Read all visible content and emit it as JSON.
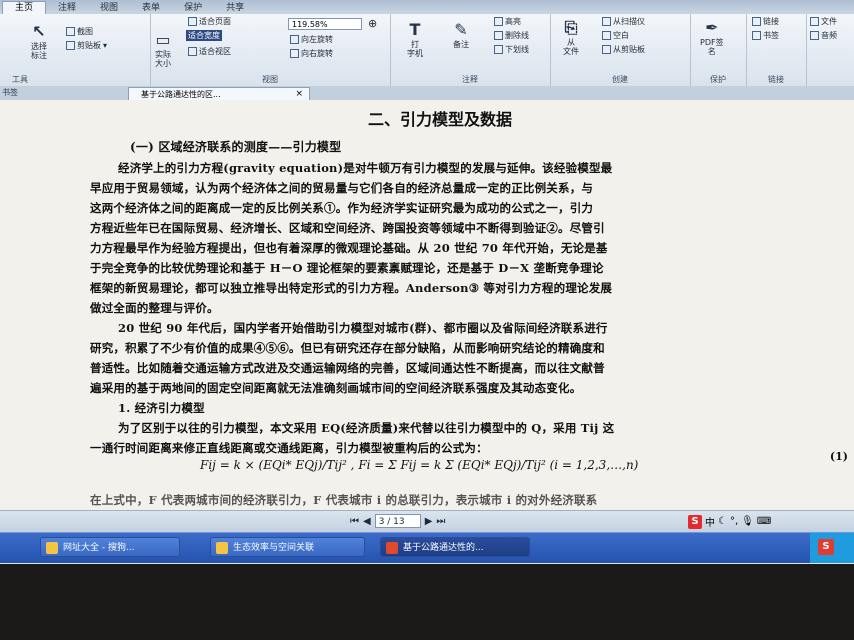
{
  "ribbon_tabs": [
    "主页",
    "注释",
    "视图",
    "表单",
    "保护",
    "共享"
  ],
  "ribbon": {
    "tools": {
      "select_annotate": "选择\n标注",
      "snapshot": "截图",
      "clipboard": "剪贴板",
      "label": "工具"
    },
    "view": {
      "actual_size": "实际\n大小",
      "fit_page": "适合页面",
      "fit_width": "适合宽度",
      "fit_visible": "适合视区",
      "zoom": "119.58%",
      "rotate_left": "向左旋转",
      "rotate_right": "向右旋转",
      "label": "视图"
    },
    "comment": {
      "typewriter": "打\n字机",
      "note": "备注",
      "highlight": "高亮",
      "strikeout": "删除线",
      "underline": "下划线",
      "label": "注释"
    },
    "create": {
      "from_file": "从\n文件",
      "from_scanner": "从扫描仪",
      "blank": "空白",
      "from_clipboard": "从剪贴板",
      "label": "创建"
    },
    "protect": {
      "pdf_sign": "PDF签\n名",
      "label": "保护"
    },
    "links": {
      "link": "链接",
      "bookmark": "书签",
      "label": "链接"
    },
    "insert": {
      "file": "文件",
      "audio": "音频"
    }
  },
  "docbar": {
    "nav_title": "书签",
    "tab_title": "基于公路通达性的区...",
    "close": "×"
  },
  "document": {
    "heading": "二、引力模型及数据",
    "section1": "(一) 区域经济联系的测度——引力模型",
    "lines": [
      "经济学上的引力方程(gravity equation)是对牛顿万有引力模型的发展与延伸。该经验模型最",
      "早应用于贸易领域，认为两个经济体之间的贸易量与它们各自的经济总量成一定的正比例关系，与",
      "这两个经济体之间的距离成一定的反比例关系①。作为经济学实证研究最为成功的公式之一，引力",
      "方程近些年已在国际贸易、经济增长、区域和空间经济、跨国投资等领域中不断得到验证②。尽管引",
      "力方程最早作为经验方程提出，但也有着深厚的微观理论基础。从 20 世纪 70 年代开始，无论是基",
      "于完全竞争的比较优势理论和基于 H－O 理论框架的要素禀赋理论，还是基于 D－X 垄断竞争理论",
      "框架的新贸易理论，都可以独立推导出特定形式的引力方程。Anderson③ 等对引力方程的理论发展",
      "做过全面的整理与评价。",
      "20 世纪 90 年代后，国内学者开始借助引力模型对城市(群)、都市圈以及省际间经济联系进行",
      "研究，积累了不少有价值的成果④⑤⑥。但已有研究还存在部分缺陷，从而影响研究结论的精确度和",
      "普适性。比如随着交通运输方式改进及交通运输网络的完善，区域间通达性不断提高，而以往文献普",
      "遍采用的基于两地间的固定空间距离就无法准确刻画城市间的空间经济联系强度及其动态变化。",
      "1. 经济引力模型",
      "为了区别于以往的引力模型，本文采用 EQ(经济质量)来代替以往引力模型中的 Q，采用 Tij 这",
      "一通行时间距离来修正直线距离或交通线距离，引力模型被重构后的公式为：",
      "在上式中，F 代表两城市间的经济联引力，F 代表城市 i 的总联引力，表示城市 i 的对外经济联系"
    ],
    "formula": "Fij = k × (EQi* EQj)/Tij² ,  Fi = Σ Fij = k Σ (EQi* EQj)/Tij² (i = 1,2,3,…,n)",
    "equation_number": "(1)"
  },
  "statusbar": {
    "page_current": "3 / 13",
    "ime_label": "中"
  },
  "taskbar": {
    "items": [
      {
        "label": "网址大全 - 搜狗..."
      },
      {
        "label": "生态效率与空间关联"
      },
      {
        "label": "基于公路通达性的..."
      }
    ],
    "tray_badge": "S"
  }
}
